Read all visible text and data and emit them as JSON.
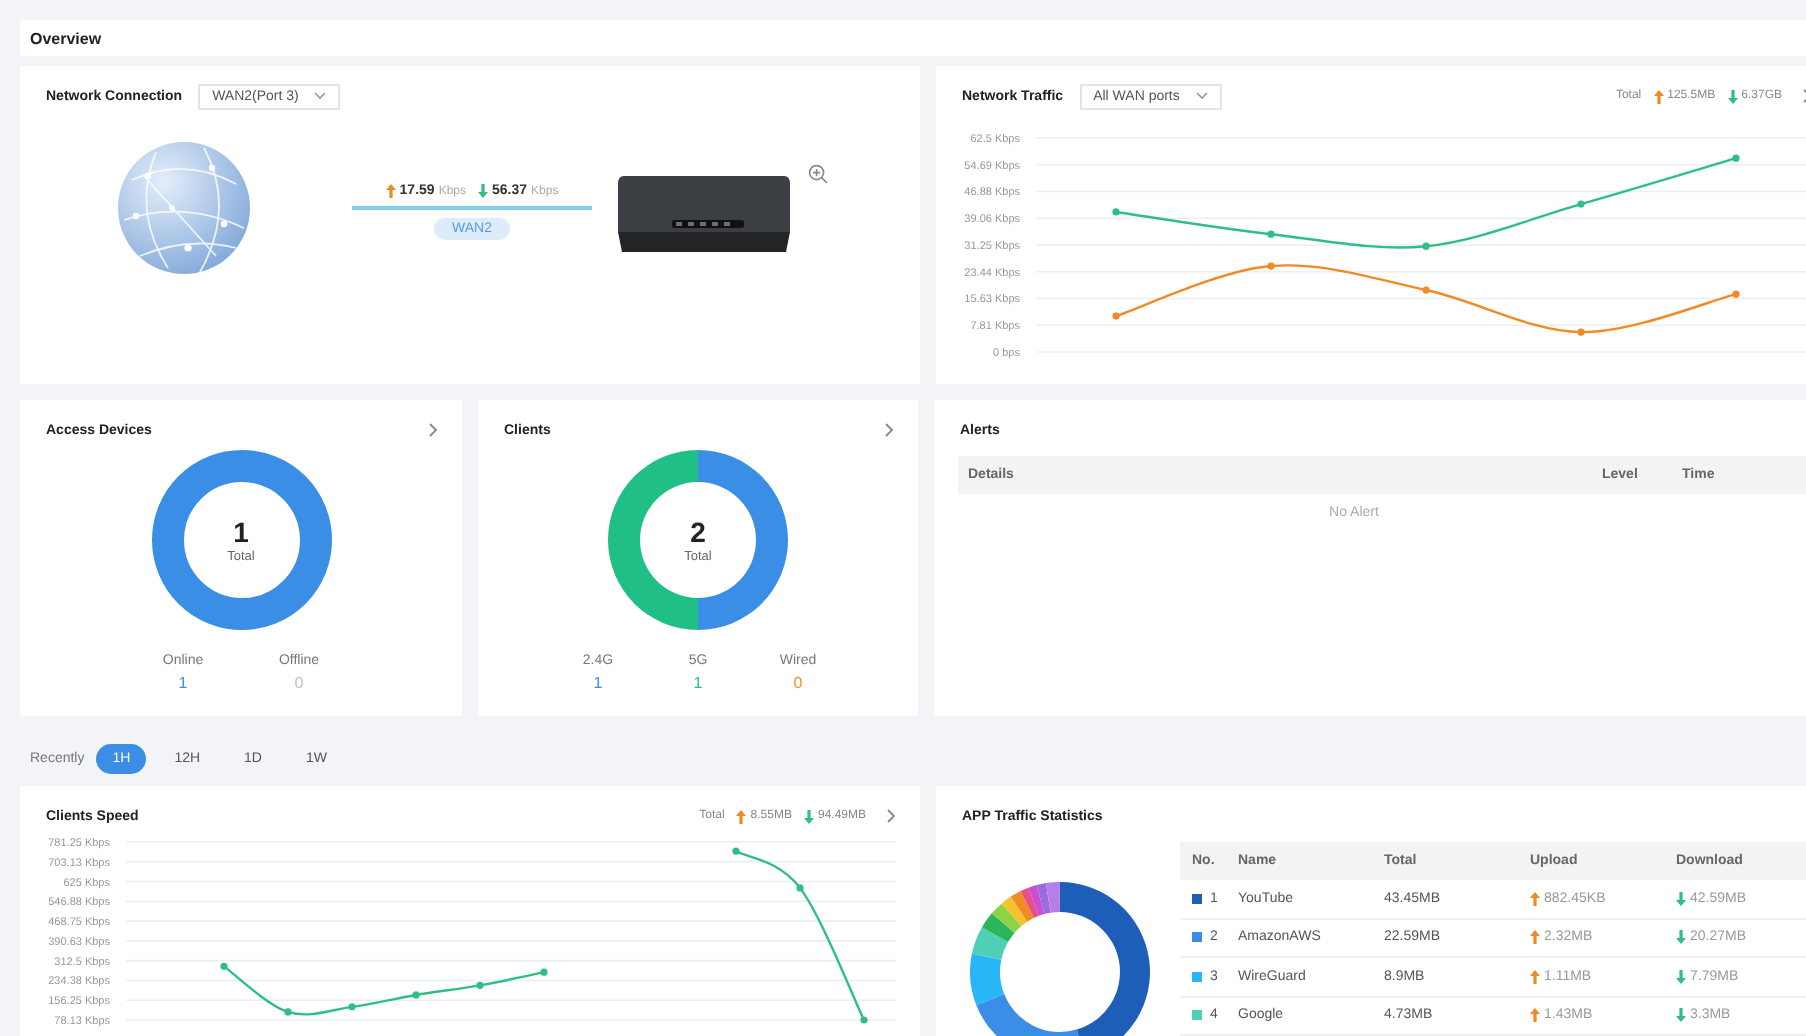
{
  "header": {
    "title": "Overview"
  },
  "network_connection": {
    "title": "Network Connection",
    "port_select": "WAN2(Port 3)",
    "upload": {
      "value": "17.59",
      "unit": "Kbps"
    },
    "download": {
      "value": "56.37",
      "unit": "Kbps"
    },
    "link_label": "WAN2"
  },
  "network_traffic": {
    "title": "Network Traffic",
    "port_select": "All WAN ports",
    "total_label": "Total",
    "total_upload": "125.5MB",
    "total_download": "6.37GB",
    "chart_data": {
      "type": "line",
      "grid": true,
      "ylim": [
        0,
        62.5
      ],
      "yticks": [
        {
          "value": 0,
          "label": "0 bps"
        },
        {
          "value": 7.81,
          "label": "7.81 Kbps"
        },
        {
          "value": 15.63,
          "label": "15.63 Kbps"
        },
        {
          "value": 23.44,
          "label": "23.44 Kbps"
        },
        {
          "value": 31.25,
          "label": "31.25 Kbps"
        },
        {
          "value": 39.06,
          "label": "39.06 Kbps"
        },
        {
          "value": 46.88,
          "label": "46.88 Kbps"
        },
        {
          "value": 54.69,
          "label": "54.69 Kbps"
        },
        {
          "value": 62.5,
          "label": "62.5 Kbps"
        }
      ],
      "series": [
        {
          "color": "#2fbf83",
          "marker": true,
          "values": [
            40.9,
            34.4,
            30.9,
            43.2,
            56.6
          ]
        },
        {
          "color": "#f08a24",
          "marker": true,
          "values": [
            10.5,
            25.1,
            18.1,
            5.8,
            16.9
          ]
        }
      ]
    }
  },
  "access_devices": {
    "title": "Access Devices",
    "total": "1",
    "total_label": "Total",
    "stats": [
      {
        "label": "Online",
        "value": "1",
        "color": "#3a8ee6"
      },
      {
        "label": "Offline",
        "value": "0",
        "color": "#c0c4cc"
      }
    ]
  },
  "clients": {
    "title": "Clients",
    "total": "2",
    "total_label": "Total",
    "stats": [
      {
        "label": "2.4G",
        "value": "1",
        "color": "#3a8ee6"
      },
      {
        "label": "5G",
        "value": "1",
        "color": "#1fbf85"
      },
      {
        "label": "Wired",
        "value": "0",
        "color": "#f0932b"
      }
    ]
  },
  "alerts": {
    "title": "Alerts",
    "columns": [
      "Details",
      "Level",
      "Time"
    ],
    "empty_text": "No Alert"
  },
  "time_range": {
    "label": "Recently",
    "options": [
      {
        "label": "1H",
        "selected": true
      },
      {
        "label": "12H",
        "selected": false
      },
      {
        "label": "1D",
        "selected": false
      },
      {
        "label": "1W",
        "selected": false
      }
    ]
  },
  "clients_speed": {
    "title": "Clients Speed",
    "total_label": "Total",
    "total_upload": "8.55MB",
    "total_download": "94.49MB",
    "chart_data": {
      "type": "line",
      "grid": true,
      "ylim": [
        78.13,
        781.25
      ],
      "yticks": [
        {
          "value": 78.13,
          "label": "78.13 Kbps"
        },
        {
          "value": 156.25,
          "label": "156.25 Kbps"
        },
        {
          "value": 234.38,
          "label": "234.38 Kbps"
        },
        {
          "value": 312.5,
          "label": "312.5 Kbps"
        },
        {
          "value": 390.63,
          "label": "390.63 Kbps"
        },
        {
          "value": 468.75,
          "label": "468.75 Kbps"
        },
        {
          "value": 546.88,
          "label": "546.88 Kbps"
        },
        {
          "value": 625,
          "label": "625 Kbps"
        },
        {
          "value": 703.13,
          "label": "703.13 Kbps"
        },
        {
          "value": 781.25,
          "label": "781.25 Kbps"
        }
      ],
      "series": [
        {
          "color": "#2fbf83",
          "marker": true,
          "values": [
            null,
            290,
            110,
            130,
            177,
            215,
            267,
            null,
            null,
            745,
            600,
            78.13
          ]
        }
      ]
    }
  },
  "app_traffic": {
    "title": "APP Traffic Statistics",
    "columns": [
      "No.",
      "Name",
      "Total",
      "Upload",
      "Download"
    ],
    "rows": [
      {
        "no": "1",
        "name": "YouTube",
        "total": "43.45MB",
        "upload": "882.45KB",
        "download": "42.59MB",
        "color": "#1d5fb8"
      },
      {
        "no": "2",
        "name": "AmazonAWS",
        "total": "22.59MB",
        "upload": "2.32MB",
        "download": "20.27MB",
        "color": "#3a8ee6"
      },
      {
        "no": "3",
        "name": "WireGuard",
        "total": "8.9MB",
        "upload": "1.11MB",
        "download": "7.79MB",
        "color": "#29b6f6"
      },
      {
        "no": "4",
        "name": "Google",
        "total": "4.73MB",
        "upload": "1.43MB",
        "download": "3.3MB",
        "color": "#4dd0b5"
      }
    ]
  }
}
